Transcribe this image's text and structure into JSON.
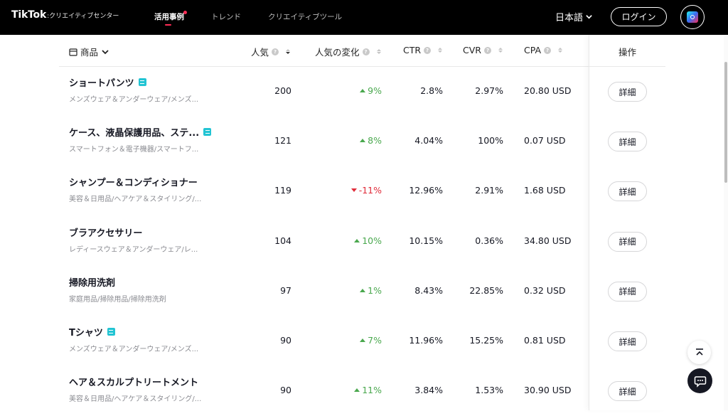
{
  "header": {
    "logo_main": "TikTok",
    "logo_sub": ":クリエイティブセンター",
    "nav": [
      {
        "label": "活用事例",
        "active": true
      },
      {
        "label": "トレンド",
        "active": false
      },
      {
        "label": "クリエイティブツール",
        "active": false
      }
    ],
    "language": "日本語",
    "login": "ログイン",
    "accent_color": "#fe2c55"
  },
  "table": {
    "columns": {
      "product": "商品",
      "popularity": "人気",
      "change": "人気の変化",
      "ctr": "CTR",
      "cvr": "CVR",
      "cpa": "CPA",
      "action": "操作"
    },
    "sorted_column": "popularity",
    "rows": [
      {
        "name": "ショートパンツ",
        "has_tag": true,
        "category": "メンズウェア＆アンダーウェア/メンズ...",
        "popularity": "200",
        "change": "9%",
        "direction": "up",
        "ctr": "2.8%",
        "cvr": "2.97%",
        "cpa": "20.80 USD",
        "action": "詳細"
      },
      {
        "name": "ケース、液晶保護用品、ステ...",
        "has_tag": true,
        "category": "スマートフォン＆電子機器/スマートフ...",
        "popularity": "121",
        "change": "8%",
        "direction": "up",
        "ctr": "4.04%",
        "cvr": "100%",
        "cpa": "0.07 USD",
        "action": "詳細"
      },
      {
        "name": "シャンプー＆コンディショナー",
        "has_tag": false,
        "category": "美容＆日用品/ヘアケア＆スタイリング/...",
        "popularity": "119",
        "change": "-11%",
        "direction": "down",
        "ctr": "12.96%",
        "cvr": "2.91%",
        "cpa": "1.68 USD",
        "action": "詳細"
      },
      {
        "name": "ブラアクセサリー",
        "has_tag": false,
        "category": "レディースウェア＆アンダーウェア/レ...",
        "popularity": "104",
        "change": "10%",
        "direction": "up",
        "ctr": "10.15%",
        "cvr": "0.36%",
        "cpa": "34.80 USD",
        "action": "詳細"
      },
      {
        "name": "掃除用洗剤",
        "has_tag": false,
        "category": "家庭用品/掃除用品/掃除用洗剤",
        "popularity": "97",
        "change": "1%",
        "direction": "up",
        "ctr": "8.43%",
        "cvr": "22.85%",
        "cpa": "0.32 USD",
        "action": "詳細"
      },
      {
        "name": "Tシャツ",
        "has_tag": true,
        "category": "メンズウェア＆アンダーウェア/メンズ...",
        "popularity": "90",
        "change": "7%",
        "direction": "up",
        "ctr": "11.96%",
        "cvr": "15.25%",
        "cpa": "0.81 USD",
        "action": "詳細"
      },
      {
        "name": "ヘア＆スカルプトリートメント",
        "has_tag": false,
        "category": "美容＆日用品/ヘアケア＆スタイリング/...",
        "popularity": "90",
        "change": "11%",
        "direction": "up",
        "ctr": "3.84%",
        "cvr": "1.53%",
        "cpa": "30.90 USD",
        "action": "詳細"
      }
    ]
  },
  "colors": {
    "positive": "#4aa84e",
    "negative": "#e02c3a",
    "tag": "#22c4d3"
  }
}
